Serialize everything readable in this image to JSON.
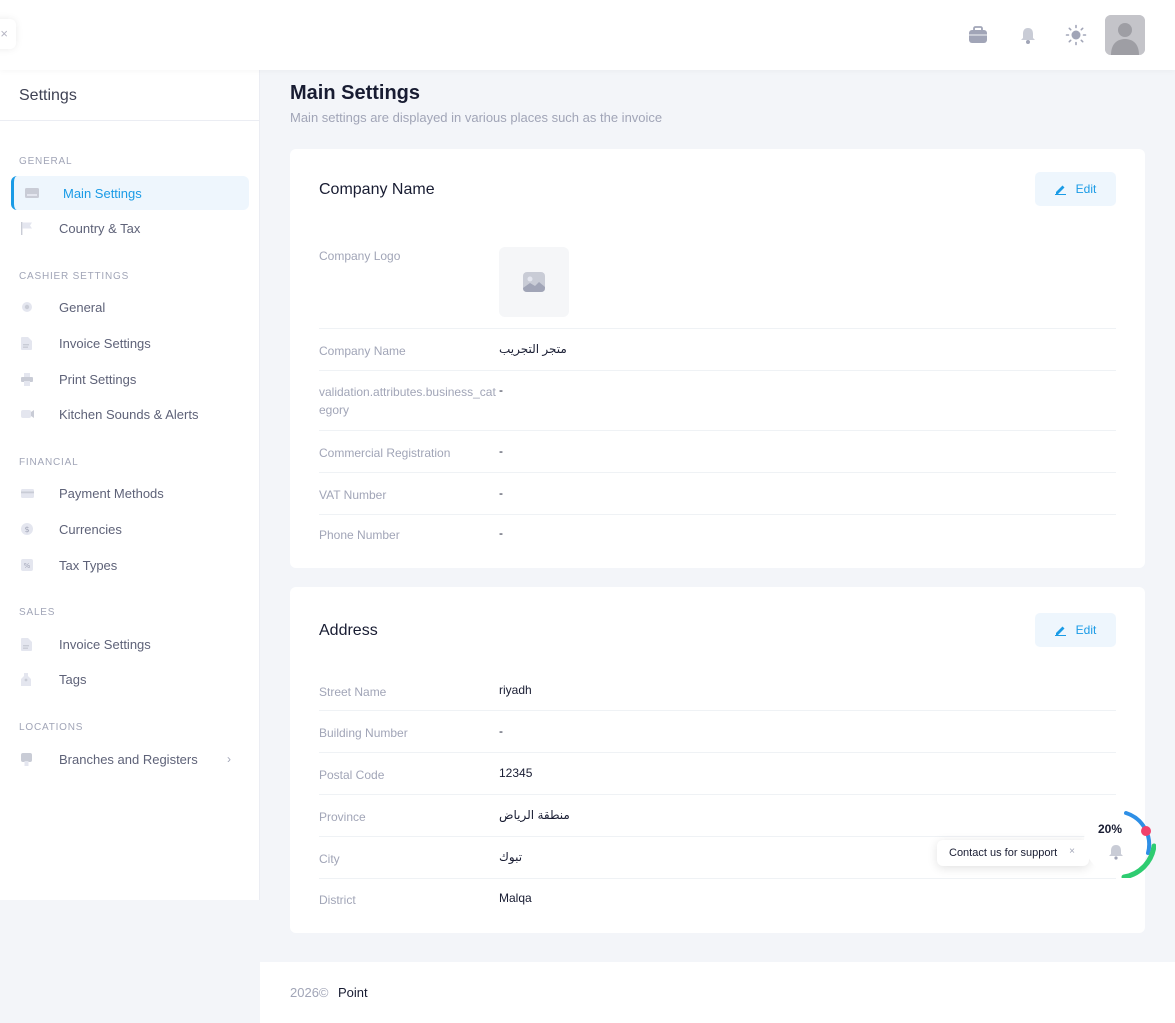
{
  "header": {
    "collapse_glyph": "×"
  },
  "sidebar": {
    "title": "Settings",
    "sections": {
      "general": "GENERAL",
      "cashier": "CASHIER SETTINGS",
      "financial": "FINANCIAL",
      "sales": "SALES",
      "locations": "LOCATIONS"
    },
    "items": {
      "main_settings": "Main Settings",
      "country_tax": "Country & Tax",
      "general": "General",
      "invoice_settings": "Invoice Settings",
      "print_settings": "Print Settings",
      "kitchen_sounds": "Kitchen Sounds & Alerts",
      "payment_methods": "Payment Methods",
      "currencies": "Currencies",
      "tax_types": "Tax Types",
      "sales_invoice_settings": "Invoice Settings",
      "tags": "Tags",
      "branches": "Branches and Registers"
    }
  },
  "main": {
    "title": "Main Settings",
    "subtitle": "Main settings are displayed in various places such as the invoice"
  },
  "company_card": {
    "title": "Company Name",
    "edit_label": "Edit",
    "rows": {
      "logo_label": "Company Logo",
      "name_label": "Company Name",
      "name_value": "متجر التجريب",
      "category_label": "validation.attributes.business_category",
      "category_value": "-",
      "cr_label": "Commercial Registration",
      "cr_value": "-",
      "vat_label": "VAT Number",
      "vat_value": "-",
      "phone_label": "Phone Number",
      "phone_value": "-"
    }
  },
  "address_card": {
    "title": "Address",
    "edit_label": "Edit",
    "rows": {
      "street_label": "Street Name",
      "street_value": "riyadh",
      "building_label": "Building Number",
      "building_value": "-",
      "postal_label": "Postal Code",
      "postal_value": "12345",
      "province_label": "Province",
      "province_value": "منطقة الرياض",
      "city_label": "City",
      "city_value": "تبوك",
      "district_label": "District",
      "district_value": "Malqa"
    }
  },
  "support": {
    "label": "Contact us for support",
    "close_glyph": "×",
    "progress_label": "20%",
    "progress": 0.2
  },
  "footer": {
    "year": "2026©",
    "brand": "Point"
  },
  "colors": {
    "accent": "#1a9be6",
    "active_bg": "#eef6fd",
    "progress_green": "#2ecc71",
    "notification_dot": "#f1416c"
  }
}
